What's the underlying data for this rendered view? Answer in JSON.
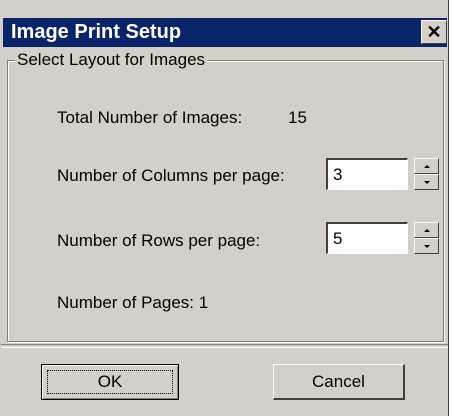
{
  "window": {
    "title": "Image Print Setup",
    "close_icon": "close-icon"
  },
  "group": {
    "legend": "Select Layout for Images"
  },
  "layout": {
    "total_images_label": "Total Number of Images:",
    "total_images_value": "15",
    "columns_label": "Number of Columns per page:",
    "columns_value": "3",
    "rows_label": "Number of Rows per page:",
    "rows_value": "5",
    "pages_label": "Number of Pages: 1"
  },
  "buttons": {
    "ok": "OK",
    "cancel": "Cancel"
  }
}
